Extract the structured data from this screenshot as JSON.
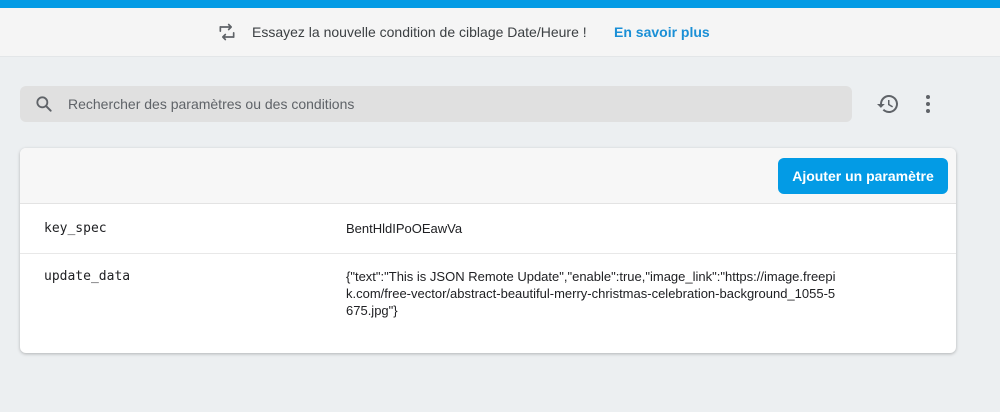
{
  "colors": {
    "accent": "#039be5",
    "link": "#1a8fd6",
    "background": "#eceff1"
  },
  "banner": {
    "icon": "swap-arrows-icon",
    "text": "Essayez la nouvelle condition de ciblage Date/Heure !",
    "link_label": "En savoir plus"
  },
  "search": {
    "icon": "search-icon",
    "placeholder": "Rechercher des paramètres ou des conditions",
    "value": ""
  },
  "toolbar": {
    "history_icon": "history-icon",
    "more_icon": "more-vert-icon"
  },
  "card": {
    "add_button_label": "Ajouter un paramètre",
    "parameters": [
      {
        "key": "key_spec",
        "value": "BentHldIPoOEawVa"
      },
      {
        "key": "update_data",
        "value": "{\"text\":\"This is JSON Remote Update\",\"enable\":true,\"image_link\":\"https://image.freepik.com/free-vector/abstract-beautiful-merry-christmas-celebration-background_1055-5675.jpg\"}"
      }
    ]
  }
}
